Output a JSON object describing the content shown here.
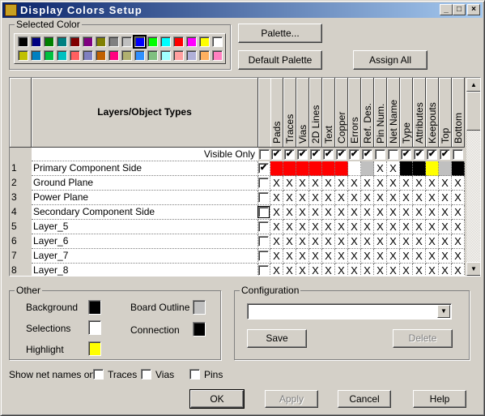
{
  "window": {
    "title": "Display Colors Setup",
    "icon_text": "PADS"
  },
  "selected_color": {
    "label": "Selected Color",
    "selected_index": 9,
    "row1": [
      "#000000",
      "#000080",
      "#008000",
      "#008080",
      "#800000",
      "#800080",
      "#808000",
      "#808080",
      "#c0c0c0",
      "#0000ff",
      "#00ff00",
      "#00ffff",
      "#ff0000",
      "#ff00ff",
      "#ffff00",
      "#ffffff"
    ],
    "row2": [
      "#c0c000",
      "#0080c0",
      "#00c040",
      "#00c0c0",
      "#ff6060",
      "#8080c0",
      "#c06000",
      "#ff0080",
      "#b0b070",
      "#3090ff",
      "#80c080",
      "#a0ffff",
      "#ffa0a0",
      "#b0b0d8",
      "#ffb060",
      "#ff80c0"
    ]
  },
  "buttons": {
    "palette": "Palette...",
    "default_palette": "Default Palette",
    "assign_all": "Assign All",
    "save": "Save",
    "delete": "Delete",
    "ok": "OK",
    "apply": "Apply",
    "cancel": "Cancel",
    "help": "Help"
  },
  "grid": {
    "layers_header": "Layers/Object Types",
    "hash_header": "#",
    "columns": [
      "Pads",
      "Traces",
      "Vias",
      "2D Lines",
      "Text",
      "Copper",
      "Errors",
      "Ref. Des.",
      "Pin Num.",
      "Net Name",
      "Type",
      "Attributes",
      "Keepouts",
      "Top",
      "Bottom"
    ],
    "visible_only_label": "Visible Only",
    "visible_only": {
      "hash": false,
      "columns": [
        true,
        true,
        true,
        true,
        true,
        true,
        true,
        true,
        false,
        false,
        true,
        true,
        true,
        true,
        false
      ]
    },
    "rows": [
      {
        "num": "1",
        "name": "Primary Component Side",
        "checked": true,
        "cells": [
          "#ff0000",
          "#ff0000",
          "#ff0000",
          "#ff0000",
          "#ff0000",
          "#ff0000",
          "#ffffff",
          "#c0c0c0",
          "X",
          "X",
          "#000000",
          "#000000",
          "#ffff00",
          "#c0c0c0",
          "#000000"
        ]
      },
      {
        "num": "2",
        "name": "Ground Plane",
        "checked": false,
        "cells": [
          "X",
          "X",
          "X",
          "X",
          "X",
          "X",
          "X",
          "X",
          "X",
          "X",
          "X",
          "X",
          "X",
          "X",
          "X"
        ]
      },
      {
        "num": "3",
        "name": "Power Plane",
        "checked": false,
        "cells": [
          "X",
          "X",
          "X",
          "X",
          "X",
          "X",
          "X",
          "X",
          "X",
          "X",
          "X",
          "X",
          "X",
          "X",
          "X"
        ]
      },
      {
        "num": "4",
        "name": "Secondary Component Side",
        "checked": false,
        "cells": [
          "X",
          "X",
          "X",
          "X",
          "X",
          "X",
          "X",
          "X",
          "X",
          "X",
          "X",
          "X",
          "X",
          "X",
          "X"
        ]
      },
      {
        "num": "5",
        "name": "Layer_5",
        "checked": false,
        "cells": [
          "X",
          "X",
          "X",
          "X",
          "X",
          "X",
          "X",
          "X",
          "X",
          "X",
          "X",
          "X",
          "X",
          "X",
          "X"
        ]
      },
      {
        "num": "6",
        "name": "Layer_6",
        "checked": false,
        "cells": [
          "X",
          "X",
          "X",
          "X",
          "X",
          "X",
          "X",
          "X",
          "X",
          "X",
          "X",
          "X",
          "X",
          "X",
          "X"
        ]
      },
      {
        "num": "7",
        "name": "Layer_7",
        "checked": false,
        "cells": [
          "X",
          "X",
          "X",
          "X",
          "X",
          "X",
          "X",
          "X",
          "X",
          "X",
          "X",
          "X",
          "X",
          "X",
          "X"
        ]
      },
      {
        "num": "8",
        "name": "Layer_8",
        "checked": false,
        "cells": [
          "X",
          "X",
          "X",
          "X",
          "X",
          "X",
          "X",
          "X",
          "X",
          "X",
          "X",
          "X",
          "X",
          "X",
          "X"
        ]
      }
    ]
  },
  "other": {
    "label": "Other",
    "background": "Background",
    "background_color": "#000000",
    "selections": "Selections",
    "selections_color": "#ffffff",
    "highlight": "Highlight",
    "highlight_color": "#ffff00",
    "board_outline": "Board Outline",
    "board_outline_color": "#c0c0c0",
    "connection": "Connection",
    "connection_color": "#000000"
  },
  "configuration": {
    "label": "Configuration",
    "value": ""
  },
  "net_names": {
    "label": "Show net names on",
    "traces": "Traces",
    "vias": "Vias",
    "pins": "Pins",
    "traces_checked": false,
    "vias_checked": false,
    "pins_checked": false
  }
}
